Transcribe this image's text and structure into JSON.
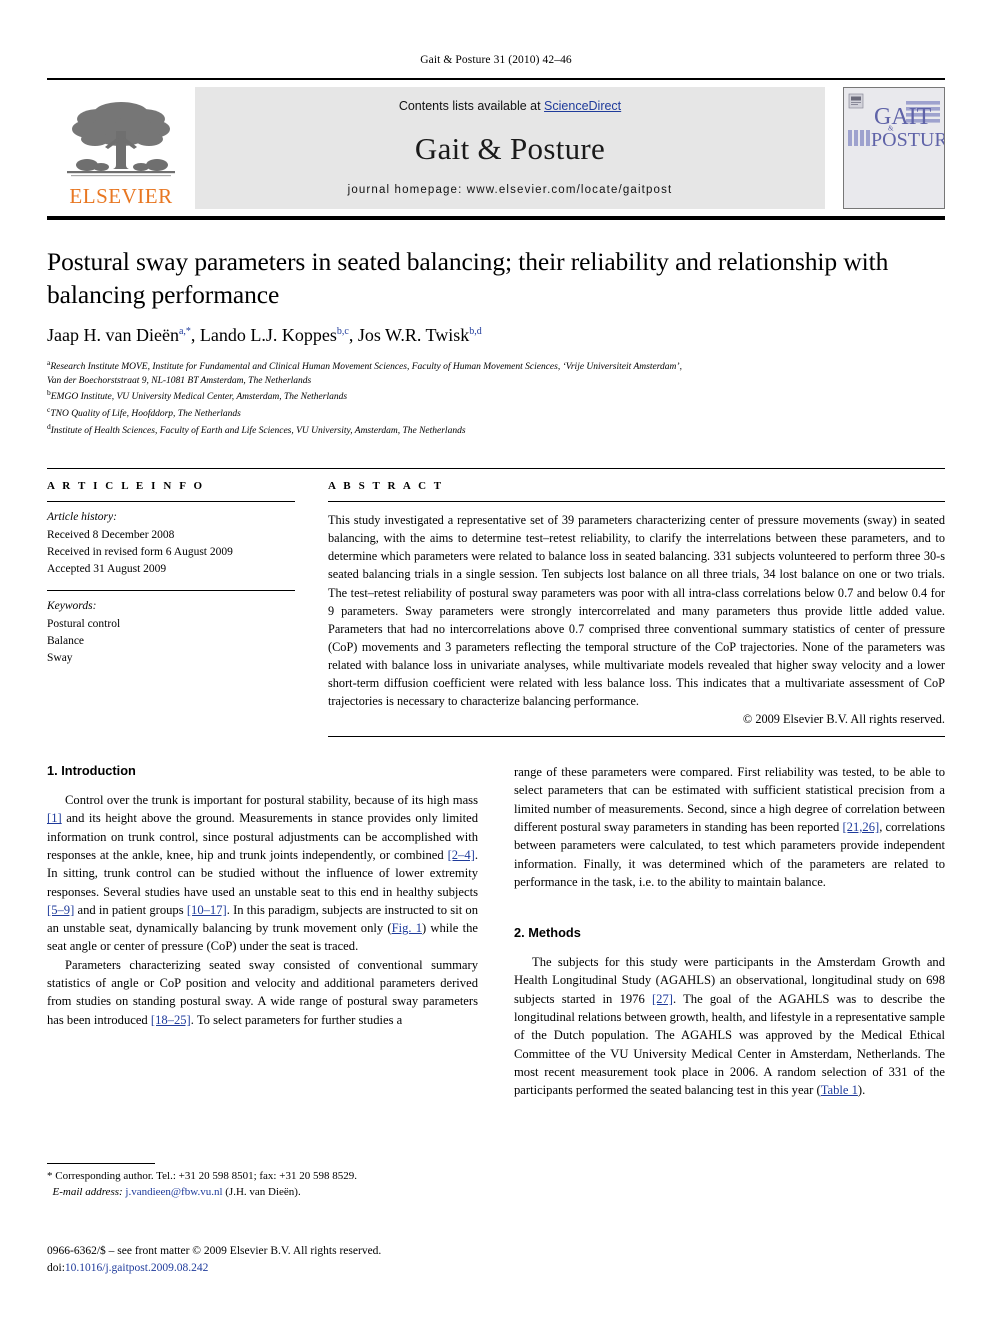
{
  "running_head": "Gait & Posture 31 (2010) 42–46",
  "masthead": {
    "publisher_name": "ELSEVIER",
    "contents_prefix": "Contents lists available at ",
    "contents_link": "ScienceDirect",
    "journal_title": "Gait & Posture",
    "homepage": "journal homepage: www.elsevier.com/locate/gaitpost",
    "cover_line1": "GAIT",
    "cover_amp": "&",
    "cover_line2": "POSTURE"
  },
  "article": {
    "title": "Postural sway parameters in seated balancing; their reliability and relationship with balancing performance",
    "authors": [
      {
        "name": "Jaap H. van Dieën",
        "sup": "a,*"
      },
      {
        "name": "Lando L.J. Koppes",
        "sup": "b,c"
      },
      {
        "name": "Jos W.R. Twisk",
        "sup": "b,d"
      }
    ],
    "affiliations": [
      {
        "sup": "a",
        "line1": "Research Institute MOVE, Institute for Fundamental and Clinical Human Movement Sciences, Faculty of Human Movement Sciences, ‘Vrije Universiteit Amsterdam’,",
        "line2": "Van der Boechorststraat 9, NL-1081 BT Amsterdam, The Netherlands"
      },
      {
        "sup": "b",
        "line1": "EMGO Institute, VU University Medical Center, Amsterdam, The Netherlands",
        "line2": ""
      },
      {
        "sup": "c",
        "line1": "TNO Quality of Life, Hoofddorp, The Netherlands",
        "line2": ""
      },
      {
        "sup": "d",
        "line1": "Institute of Health Sciences, Faculty of Earth and Life Sciences, VU University, Amsterdam, The Netherlands",
        "line2": ""
      }
    ]
  },
  "article_info": {
    "heading": "A R T I C L E   I N F O",
    "history_label": "Article history:",
    "history": [
      "Received 8 December 2008",
      "Received in revised form 6 August 2009",
      "Accepted 31 August 2009"
    ],
    "keywords_label": "Keywords:",
    "keywords": [
      "Postural control",
      "Balance",
      "Sway"
    ]
  },
  "abstract": {
    "heading": "A B S T R A C T",
    "text": "This study investigated a representative set of 39 parameters characterizing center of pressure movements (sway) in seated balancing, with the aims to determine test–retest reliability, to clarify the interrelations between these parameters, and to determine which parameters were related to balance loss in seated balancing. 331 subjects volunteered to perform three 30-s seated balancing trials in a single session. Ten subjects lost balance on all three trials, 34 lost balance on one or two trials. The test–retest reliability of postural sway parameters was poor with all intra-class correlations below 0.7 and below 0.4 for 9 parameters. Sway parameters were strongly intercorrelated and many parameters thus provide little added value. Parameters that had no intercorrelations above 0.7 comprised three conventional summary statistics of center of pressure (CoP) movements and 3 parameters reflecting the temporal structure of the CoP trajectories. None of the parameters was related with balance loss in univariate analyses, while multivariate models revealed that higher sway velocity and a lower short-term diffusion coefficient were related with less balance loss. This indicates that a multivariate assessment of CoP trajectories is necessary to characterize balancing performance.",
    "copyright": "© 2009 Elsevier B.V. All rights reserved."
  },
  "sections": {
    "introduction_heading": "1. Introduction",
    "methods_heading": "2. Methods",
    "intro_p1_a": "Control over the trunk is important for postural stability, because of its high mass ",
    "intro_p1_r1": "[1]",
    "intro_p1_b": " and its height above the ground. Measurements in stance provides only limited information on trunk control, since postural adjustments can be accomplished with responses at the ankle, knee, hip and trunk joints independently, or combined ",
    "intro_p1_r2": "[2–4]",
    "intro_p1_c": ". In sitting, trunk control can be studied without the influence of lower extremity responses. Several studies have used an unstable seat to this end in healthy subjects ",
    "intro_p1_r3": "[5–9]",
    "intro_p1_d": " and in patient groups ",
    "intro_p1_r4": "[10–17]",
    "intro_p1_e": ". In this paradigm, subjects are instructed to sit on an unstable seat, dynamically balancing by trunk movement only (",
    "intro_p1_r5": "Fig. 1",
    "intro_p1_f": ") while the seat angle or center of pressure (CoP) under the seat is traced.",
    "intro_p2_a": "Parameters characterizing seated sway consisted of conventional summary statistics of angle or CoP position and velocity and additional parameters derived from studies on standing postural sway. A wide range of postural sway parameters has been introduced ",
    "intro_p2_r1": "[18–25]",
    "intro_p2_b": ". To select parameters for further studies a",
    "intro_p3_a": "range of these parameters were compared. First reliability was tested, to be able to select parameters that can be estimated with sufficient statistical precision from a limited number of measurements. Second, since a high degree of correlation between different postural sway parameters in standing has been reported ",
    "intro_p3_r1": "[21,26]",
    "intro_p3_b": ", correlations between parameters were calculated, to test which parameters provide independent information. Finally, it was determined which of the parameters are related to performance in the task, i.e. to the ability to maintain balance.",
    "methods_p1_a": "The subjects for this study were participants in the Amsterdam Growth and Health Longitudinal Study (AGAHLS) an observational, longitudinal study on 698 subjects started in 1976 ",
    "methods_p1_r1": "[27]",
    "methods_p1_b": ". The goal of the AGAHLS was to describe the longitudinal relations between growth, health, and lifestyle in a representative sample of the Dutch population. The AGAHLS was approved by the Medical Ethical Committee of the VU University Medical Center in Amsterdam, Netherlands. The most recent measurement took place in 2006. A random selection of 331 of the participants performed the seated balancing test in this year (",
    "methods_p1_r2": "Table 1",
    "methods_p1_c": ")."
  },
  "footnotes": {
    "corresponding": "* Corresponding author. Tel.: +31 20 598 8501; fax: +31 20 598 8529.",
    "email_label": "E-mail address:",
    "email": "j.vandieen@fbw.vu.nl",
    "email_suffix": "(J.H. van Dieën).",
    "issn_line": "0966-6362/$ – see front matter © 2009 Elsevier B.V. All rights reserved.",
    "doi_label": "doi:",
    "doi": "10.1016/j.gaitpost.2009.08.242"
  },
  "colors": {
    "link": "#1f3b9b",
    "elsevier_orange": "#E87722",
    "band_gray": "#e6e6e6",
    "cover_purple": "#6b6fae"
  }
}
